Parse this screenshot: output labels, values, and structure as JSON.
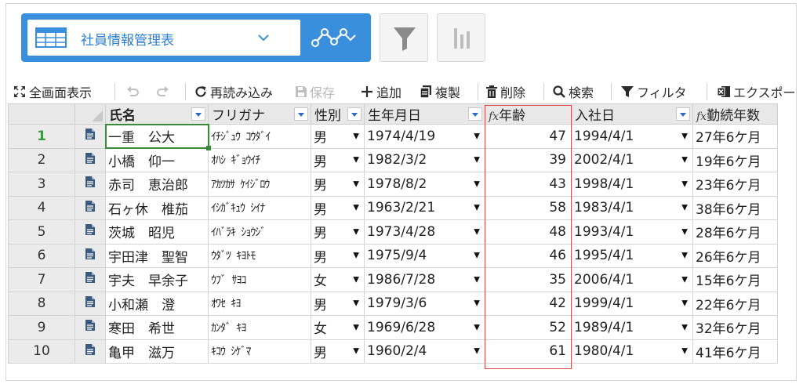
{
  "app": {
    "table_name": "社員情報管理表",
    "icons": {
      "table": "table-icon",
      "app_dropdown": "chevron-down-icon",
      "graph": "graph-icon",
      "filter_tool": "funnel-icon",
      "chart_tool": "bar-chart-icon"
    },
    "accent_color": "#3a8fdc"
  },
  "toolbar": {
    "fullscreen": "全画面表示",
    "reload": "再読み込み",
    "save": "保存",
    "add": "追加",
    "duplicate": "複製",
    "delete": "削除",
    "search": "検索",
    "filter": "フィルタ",
    "export": "エクスポー"
  },
  "grid": {
    "columns": {
      "name": "氏名",
      "kana": "フリガナ",
      "gender": "性別",
      "birth": "生年月日",
      "age": "年齢",
      "joined": "入社日",
      "tenure": "勤続年数"
    },
    "fx_mark": "fx",
    "rows": [
      {
        "no": "1",
        "name": "一重　公大",
        "kana": "ｲﾁｼﾞｭｳ ｺｳﾀﾞｲ",
        "gender": "男",
        "birth": "1974/4/19",
        "age": "47",
        "joined": "1994/4/1",
        "tenure": "27年6ケ月"
      },
      {
        "no": "2",
        "name": "小橋　仰一",
        "kana": "ｵﾊｼ ｷﾞｮｳｲﾁ",
        "gender": "男",
        "birth": "1982/3/2",
        "age": "39",
        "joined": "2002/4/1",
        "tenure": "19年6ケ月"
      },
      {
        "no": "3",
        "name": "赤司　恵治郎",
        "kana": "ｱｶﾂｶｻ ｹｲｼﾞﾛｳ",
        "gender": "男",
        "birth": "1978/8/2",
        "age": "43",
        "joined": "1998/4/1",
        "tenure": "23年6ケ月"
      },
      {
        "no": "4",
        "name": "石ヶ休　椎茄",
        "kana": "ｲｼｶﾞｷｭｳ ｼｲﾅ",
        "gender": "男",
        "birth": "1963/2/21",
        "age": "58",
        "joined": "1983/4/1",
        "tenure": "38年6ケ月"
      },
      {
        "no": "5",
        "name": "茨城　昭児",
        "kana": "ｲﾊﾞﾗｷ ｼｮｳｼﾞ",
        "gender": "男",
        "birth": "1973/4/28",
        "age": "48",
        "joined": "1993/4/1",
        "tenure": "28年6ケ月"
      },
      {
        "no": "6",
        "name": "宇田津　聖智",
        "kana": "ｳﾀﾞﾂ ｷﾖﾄﾓ",
        "gender": "男",
        "birth": "1975/9/4",
        "age": "46",
        "joined": "1995/4/1",
        "tenure": "26年6ケ月"
      },
      {
        "no": "7",
        "name": "宇夫　早余子",
        "kana": "ｳﾌﾞ ｻﾖｺ",
        "gender": "女",
        "birth": "1986/7/28",
        "age": "35",
        "joined": "2006/4/1",
        "tenure": "15年6ケ月"
      },
      {
        "no": "8",
        "name": "小和瀬　澄",
        "kana": "ｵﾜｾ ｷﾖ",
        "gender": "男",
        "birth": "1979/3/6",
        "age": "42",
        "joined": "1999/4/1",
        "tenure": "22年6ケ月"
      },
      {
        "no": "9",
        "name": "寒田　希世",
        "kana": "ｶﾝﾀﾞ ｷﾖ",
        "gender": "女",
        "birth": "1969/6/28",
        "age": "52",
        "joined": "1989/4/1",
        "tenure": "32年6ケ月"
      },
      {
        "no": "10",
        "name": "亀甲　滋万",
        "kana": "ｷｺｳ ｼｹﾞﾏ",
        "gender": "男",
        "birth": "1960/2/4",
        "age": "61",
        "joined": "1980/4/1",
        "tenure": "41年6ケ月"
      }
    ]
  }
}
